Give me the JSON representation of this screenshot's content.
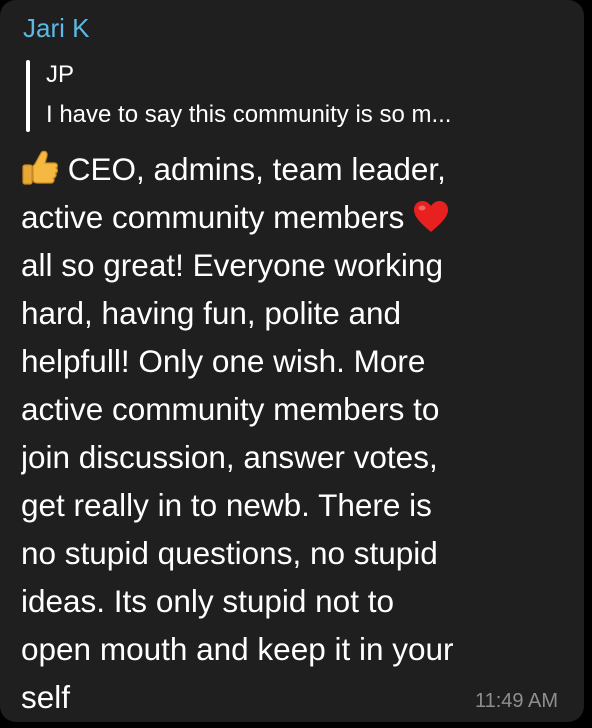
{
  "message": {
    "sender": "Jari K",
    "sender_color": "#5cb8e4",
    "reply": {
      "author": "JP",
      "text": "I have to say this community is so m..."
    },
    "body_lines": {
      "l1": "CEO, admins, team leader,",
      "l2": "active community members",
      "l3": "all so great! Everyone working",
      "l4": "hard, having fun, polite and",
      "l5": "helpfull! Only one wish. More",
      "l6": "active community members to",
      "l7": "join discussion, answer votes,",
      "l8": "get really in to newb. There is",
      "l9": "no stupid questions, no stupid",
      "l10": "ideas. Its only stupid not to",
      "l11": "open mouth and keep it in your",
      "l12": "self"
    },
    "emojis": {
      "thumbs_up": "thumbs-up-icon",
      "heart": "red-heart-icon"
    },
    "timestamp": "11:49 AM",
    "bubble_color": "#1f1f1f"
  }
}
